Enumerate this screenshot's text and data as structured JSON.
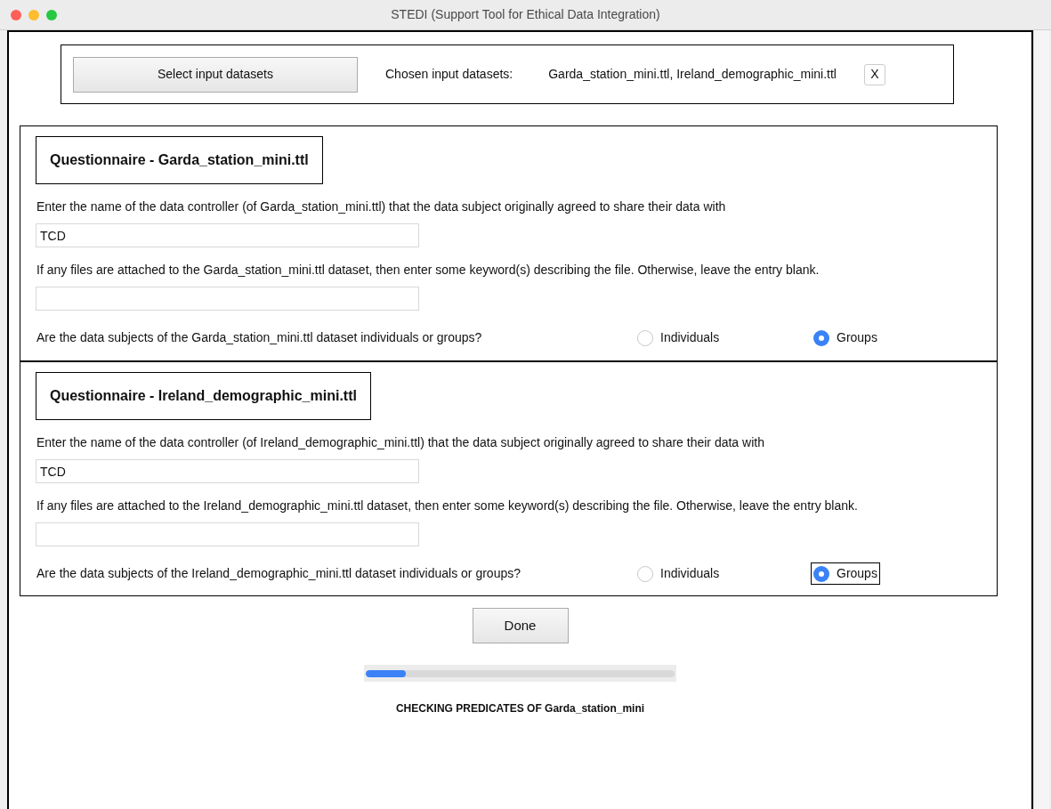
{
  "window": {
    "title": "STEDI (Support Tool for Ethical Data Integration)"
  },
  "input_bar": {
    "button": "Select input datasets",
    "label": "Chosen input datasets:",
    "value": "Garda_station_mini.ttl, Ireland_demographic_mini.ttl",
    "clear_button": "X"
  },
  "questionnaires": [
    {
      "title": "Questionnaire - Garda_station_mini.ttl",
      "controller_question": "Enter the name of the data controller (of Garda_station_mini.ttl) that the data subject originally agreed to share their data with",
      "controller_value": "TCD",
      "files_question": "If any files are attached to the Garda_station_mini.ttl dataset, then enter some keyword(s) describing the file. Otherwise, leave the entry blank.",
      "subjects_question": "Are the data subjects of the Garda_station_mini.ttl dataset individuals or groups?",
      "options": [
        {
          "label": "Individuals",
          "selected": false,
          "focused": false
        },
        {
          "label": "Groups",
          "selected": true,
          "focused": false
        }
      ]
    },
    {
      "title": "Questionnaire - Ireland_demographic_mini.ttl",
      "controller_question": "Enter the name of the data controller (of Ireland_demographic_mini.ttl) that the data subject originally agreed to share their data with",
      "controller_value": "TCD",
      "files_question": "If any files are attached to the Ireland_demographic_mini.ttl dataset, then enter some keyword(s) describing the file. Otherwise, leave the entry blank.",
      "subjects_question": "Are the data subjects of the Ireland_demographic_mini.ttl dataset individuals or groups?",
      "options": [
        {
          "label": "Individuals",
          "selected": false,
          "focused": false
        },
        {
          "label": "Groups",
          "selected": true,
          "focused": true
        }
      ]
    }
  ],
  "done_button": "Done",
  "progress": {
    "level": 0.13
  },
  "status": "CHECKING PREDICATES OF Garda_station_mini"
}
